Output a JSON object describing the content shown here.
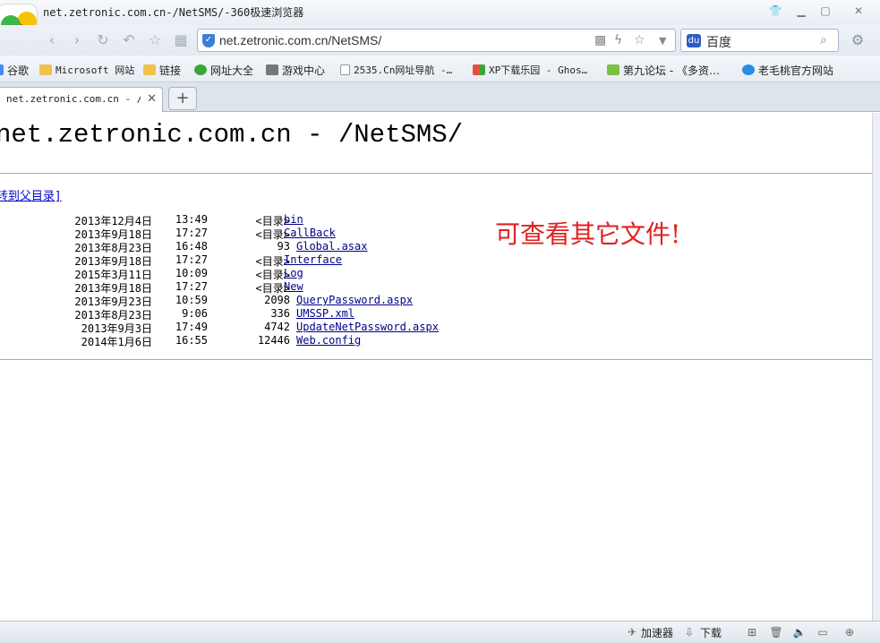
{
  "window": {
    "title": "net.zetronic.com.cn-/NetSMS/-360极速浏览器"
  },
  "toolbar": {
    "address": "net.zetronic.com.cn/NetSMS/",
    "search_engine": "百度"
  },
  "bookmarks": [
    {
      "label": "谷歌",
      "icon": "google-icon"
    },
    {
      "label": "Microsoft 网站",
      "icon": "folder-icon"
    },
    {
      "label": "链接",
      "icon": "folder-icon"
    },
    {
      "label": "网址大全",
      "icon": "globe-icon"
    },
    {
      "label": "游戏中心",
      "icon": "gamepad-icon"
    },
    {
      "label": "2535.Cn网址导航 -…",
      "icon": "page-icon"
    },
    {
      "label": "XP下载乐园 - Ghos…",
      "icon": "windows-icon"
    },
    {
      "label": "第九论坛 - 《多资…",
      "icon": "forum-icon"
    },
    {
      "label": "老毛桃官方网站",
      "icon": "ie-icon"
    }
  ],
  "tab": {
    "label": "net.zetronic.com.cn - /Ne",
    "new_tab": "+"
  },
  "page": {
    "heading": "net.zetronic.com.cn - /NetSMS/",
    "parent_link": "[转到父目录]",
    "note": "可查看其它文件!",
    "entries": [
      {
        "date": "2013年12月4日",
        "time": "13:49",
        "size": "<目录>",
        "name": "bin"
      },
      {
        "date": "2013年9月18日",
        "time": "17:27",
        "size": "<目录>",
        "name": "CallBack"
      },
      {
        "date": "2013年8月23日",
        "time": "16:48",
        "size": "93",
        "name": "Global.asax"
      },
      {
        "date": "2013年9月18日",
        "time": "17:27",
        "size": "<目录>",
        "name": "Interface"
      },
      {
        "date": "2015年3月11日",
        "time": "10:09",
        "size": "<目录>",
        "name": "Log"
      },
      {
        "date": "2013年9月18日",
        "time": "17:27",
        "size": "<目录>",
        "name": "New"
      },
      {
        "date": "2013年9月23日",
        "time": "10:59",
        "size": "2098",
        "name": "QueryPassword.aspx"
      },
      {
        "date": "2013年8月23日",
        "time": "9:06",
        "size": "336",
        "name": "UMSSP.xml"
      },
      {
        "date": "2013年9月3日",
        "time": "17:49",
        "size": "4742",
        "name": "UpdateNetPassword.aspx"
      },
      {
        "date": "2014年1月6日",
        "time": "16:55",
        "size": "12446",
        "name": "Web.config"
      }
    ]
  },
  "statusbar": {
    "accelerator": "加速器",
    "download": "下载"
  },
  "colors": {
    "link": "#00008b",
    "note": "#e02020",
    "chrome_bg": "#e3e9f1"
  }
}
